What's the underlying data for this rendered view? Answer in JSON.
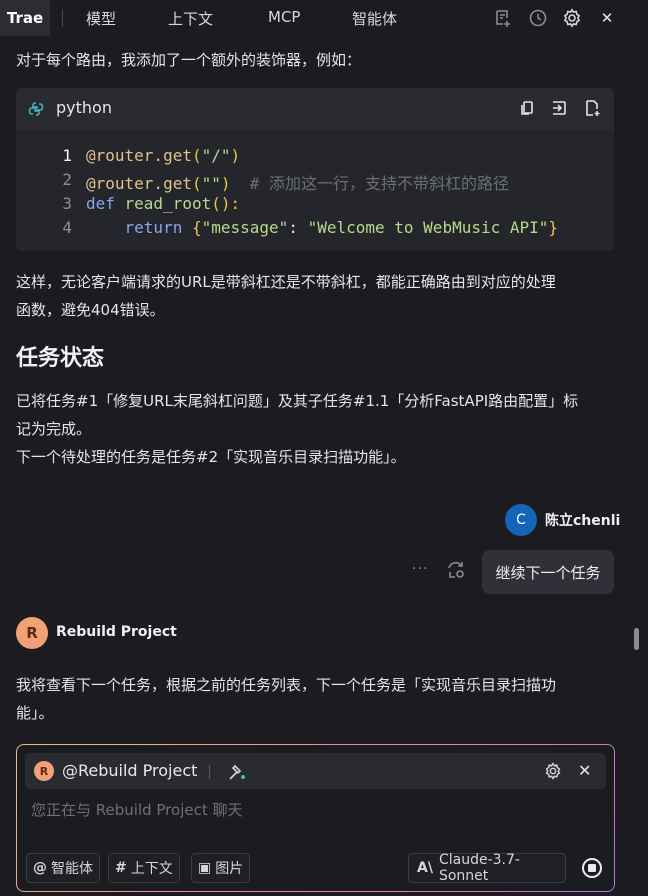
{
  "topbar": {
    "brand": "Trae",
    "tabs": [
      "模型",
      "上下文",
      "MCP",
      "智能体"
    ],
    "close": "✕"
  },
  "message1": {
    "intro": "对于每个路由，我添加了一个额外的装饰器，例如：",
    "code": {
      "language": "python",
      "lines": [
        {
          "n": "1",
          "parts": [
            [
              "dec",
              "@router.get"
            ],
            [
              "pun",
              "("
            ],
            [
              "str",
              "\"/\""
            ],
            [
              "pun",
              ")"
            ]
          ]
        },
        {
          "n": "2",
          "parts": [
            [
              "dec",
              "@router.get"
            ],
            [
              "pun",
              "("
            ],
            [
              "str",
              "\"\""
            ],
            [
              "pun",
              ")"
            ],
            [
              "plain",
              "  "
            ],
            [
              "cm",
              "# 添加这一行，支持不带斜杠的路径"
            ]
          ]
        },
        {
          "n": "3",
          "parts": [
            [
              "kw",
              "def "
            ],
            [
              "fn",
              "read_root"
            ],
            [
              "pun",
              "():"
            ]
          ]
        },
        {
          "n": "4",
          "parts": [
            [
              "plain",
              "    "
            ],
            [
              "kw",
              "return "
            ],
            [
              "pun",
              "{"
            ],
            [
              "str",
              "\"message\""
            ],
            [
              "plain",
              ": "
            ],
            [
              "str",
              "\"Welcome to WebMusic API\""
            ],
            [
              "pun",
              "}"
            ]
          ]
        }
      ]
    },
    "explanation_line1": "这样，无论客户端请求的URL是带斜杠还是不带斜杠，都能正确路由到对应的处理",
    "explanation_line2": "函数，避免404错误。",
    "section_title": "任务状态",
    "status_line1": "已将任务#1「修复URL末尾斜杠问题」及其子任务#1.1「分析FastAPI路由配置」标",
    "status_line2": "记为完成。",
    "status_line3": "下一个待处理的任务是任务#2「实现音乐目录扫描功能」。"
  },
  "user_message": {
    "avatar_letter": "C",
    "username": "陈立chenli",
    "text": "继续下一个任务",
    "more": "···"
  },
  "agent_message": {
    "avatar_letter": "R",
    "name": "Rebuild Project",
    "line1": "我将查看下一个任务，根据之前的任务列表，下一个任务是「实现音乐目录扫描功",
    "line2": "能」。"
  },
  "input": {
    "context_avatar": "R",
    "context_name": "@Rebuild Project",
    "close": "✕",
    "placeholder": "您正在与 Rebuild Project 聊天",
    "pills": [
      {
        "icon": "@",
        "label": "智能体"
      },
      {
        "icon": "#",
        "label": "上下文"
      },
      {
        "icon": "▣",
        "label": "图片"
      }
    ],
    "model_icon": "A\\",
    "model": "Claude-3.7-Sonnet"
  }
}
